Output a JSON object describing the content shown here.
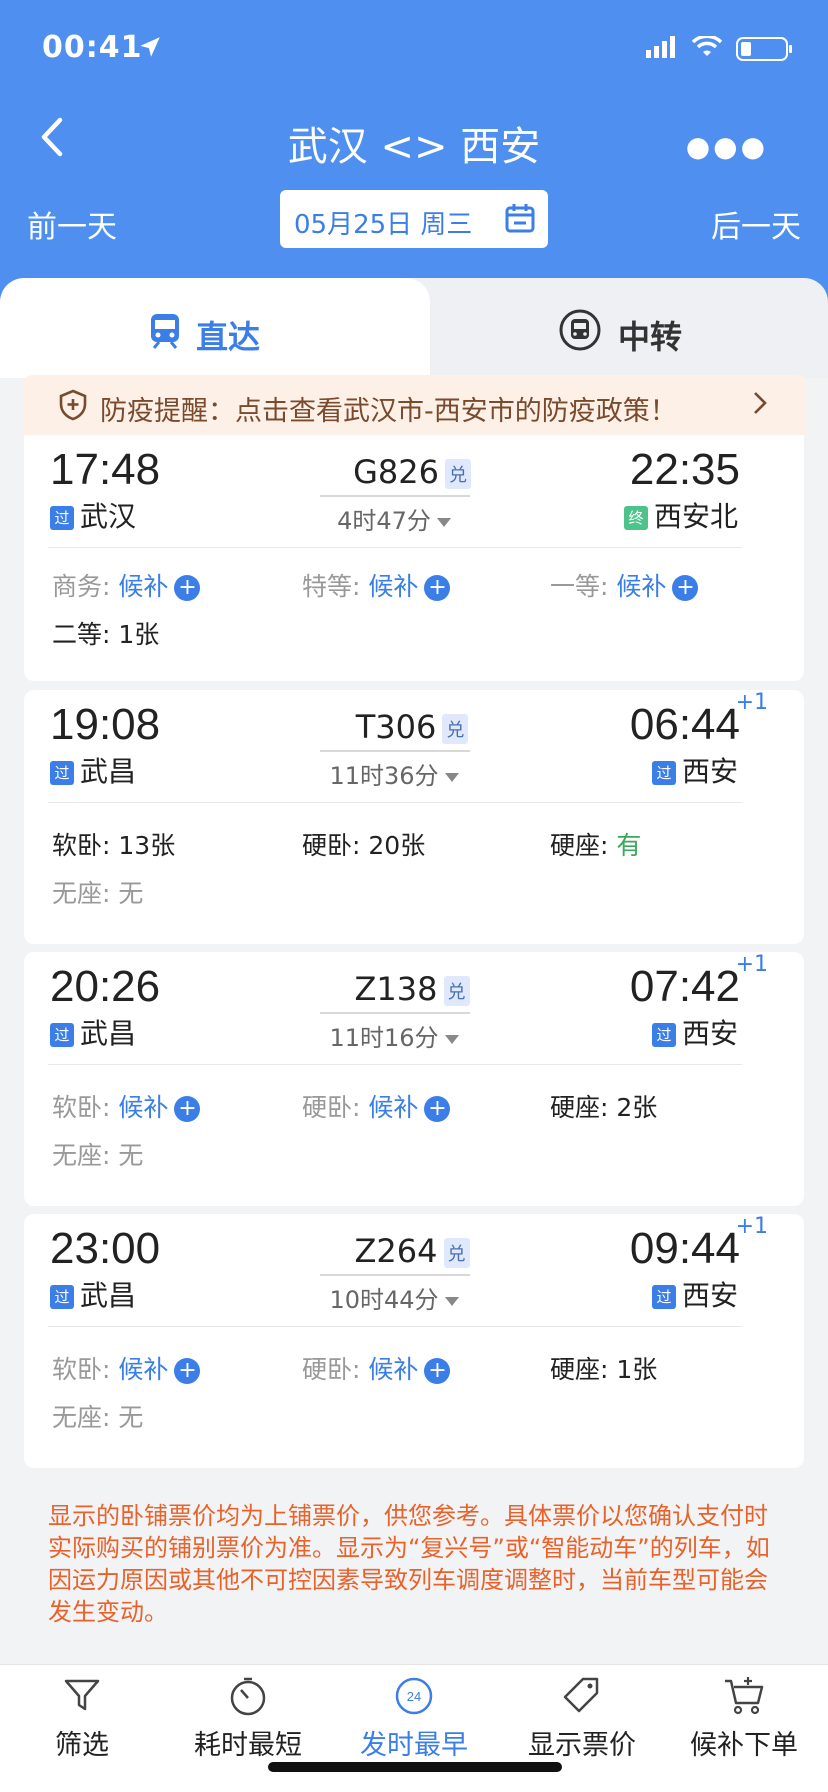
{
  "status": {
    "time": "00:41"
  },
  "nav": {
    "title": "武汉 <> 西安"
  },
  "datebar": {
    "prev": "前一天",
    "date": "05月25日 周三",
    "next": "后一天"
  },
  "tabs": [
    {
      "label": "直达"
    },
    {
      "label": "中转"
    }
  ],
  "notice": {
    "text": "防疫提醒：点击查看武汉市-西安市的防疫政策！"
  },
  "trains": [
    {
      "dep_time": "17:48",
      "arr_time": "22:35",
      "plus_day": "",
      "code": "G826",
      "dui": "兑",
      "duration": "4时47分",
      "from_badge": "过",
      "from": "武汉",
      "to_badge": "终",
      "to": "西安北",
      "seats": [
        {
          "k": "商务:",
          "v": "候补"
        },
        {
          "k": "特等:",
          "v": "候补"
        },
        {
          "k": "一等:",
          "v": "候补"
        },
        {
          "k": "二等:",
          "v": "1张"
        }
      ]
    },
    {
      "dep_time": "19:08",
      "arr_time": "06:44",
      "plus_day": "+1",
      "code": "T306",
      "dui": "兑",
      "duration": "11时36分",
      "from_badge": "过",
      "from": "武昌",
      "to_badge": "过",
      "to": "西安",
      "seats": [
        {
          "k": "软卧:",
          "v": "13张"
        },
        {
          "k": "硬卧:",
          "v": "20张"
        },
        {
          "k": "硬座:",
          "v": "有"
        },
        {
          "k": "无座:",
          "v": "无"
        }
      ]
    },
    {
      "dep_time": "20:26",
      "arr_time": "07:42",
      "plus_day": "+1",
      "code": "Z138",
      "dui": "兑",
      "duration": "11时16分",
      "from_badge": "过",
      "from": "武昌",
      "to_badge": "过",
      "to": "西安",
      "seats": [
        {
          "k": "软卧:",
          "v": "候补"
        },
        {
          "k": "硬卧:",
          "v": "候补"
        },
        {
          "k": "硬座:",
          "v": "2张"
        },
        {
          "k": "无座:",
          "v": "无"
        }
      ]
    },
    {
      "dep_time": "23:00",
      "arr_time": "09:44",
      "plus_day": "+1",
      "code": "Z264",
      "dui": "兑",
      "duration": "10时44分",
      "from_badge": "过",
      "from": "武昌",
      "to_badge": "过",
      "to": "西安",
      "seats": [
        {
          "k": "软卧:",
          "v": "候补"
        },
        {
          "k": "硬卧:",
          "v": "候补"
        },
        {
          "k": "硬座:",
          "v": "1张"
        },
        {
          "k": "无座:",
          "v": "无"
        }
      ]
    }
  ],
  "footnote": "显示的卧铺票价均为上铺票价，供您参考。具体票价以您确认支付时实际购买的铺别票价为准。显示为“复兴号”或“智能动车”的列车，如因运力原因或其他不可控因素导致列车调度调整时，当前车型可能会发生变动。",
  "bottom": [
    {
      "label": "筛选"
    },
    {
      "label": "耗时最短"
    },
    {
      "label": "发时最早",
      "icon_text": "24"
    },
    {
      "label": "显示票价"
    },
    {
      "label": "候补下单"
    }
  ],
  "colors": {
    "brand": "#4f8ff0",
    "accent": "#3b7ee8",
    "warn": "#e8622a",
    "ok": "#3aa95b"
  }
}
